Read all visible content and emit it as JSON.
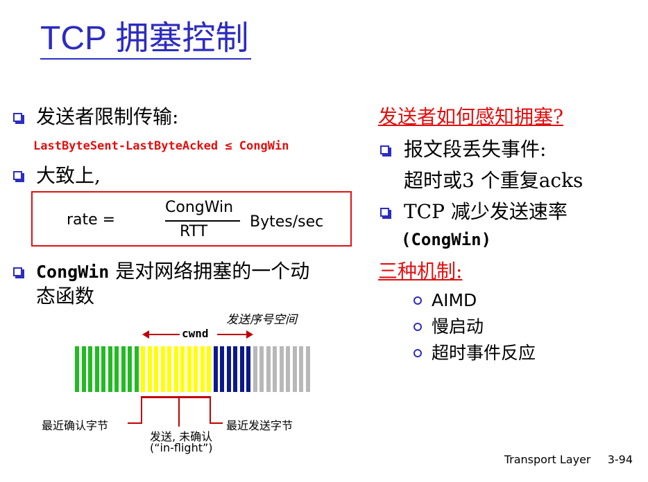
{
  "title": "TCP 拥塞控制",
  "left": {
    "item1": "发送者限制传输:",
    "code_line": "LastByteSent-LastByteAcked ≤ CongWin",
    "item2": "大致上,",
    "formula": {
      "lhs": "rate =",
      "numerator": "CongWin",
      "denominator": "RTT",
      "unit": "Bytes/sec"
    },
    "item3_code": "CongWin",
    "item3_text": "是对网络拥塞的一个动",
    "item3_text2": "态函数"
  },
  "diagram": {
    "seq_space_label": "发送序号空间",
    "cwnd_label": "cwnd",
    "label_last_acked": "最近确认字节",
    "label_last_sent": "最近发送字节",
    "label_inflight_1": "发送, 未确认",
    "label_inflight_2": "(“in-flight”)",
    "colors": {
      "acked": "#22bb22",
      "inflight": "#ffff00",
      "usable": "#0a1a8a",
      "unusable": "#b8b8b8",
      "pointer": "#c00000"
    }
  },
  "right": {
    "heading1": "发送者如何感知拥塞?",
    "item1_line1": "报文段丢失事件:",
    "item1_line2": "超时或3 个重复acks",
    "item2_line1": "TCP 减少发送速率",
    "item2_line2": "(CongWin)",
    "heading2": "三种机制:",
    "mechanisms": [
      "AIMD",
      "慢启动",
      "超时事件反应"
    ]
  },
  "footer": {
    "label": "Transport Layer",
    "page": "3-94"
  }
}
